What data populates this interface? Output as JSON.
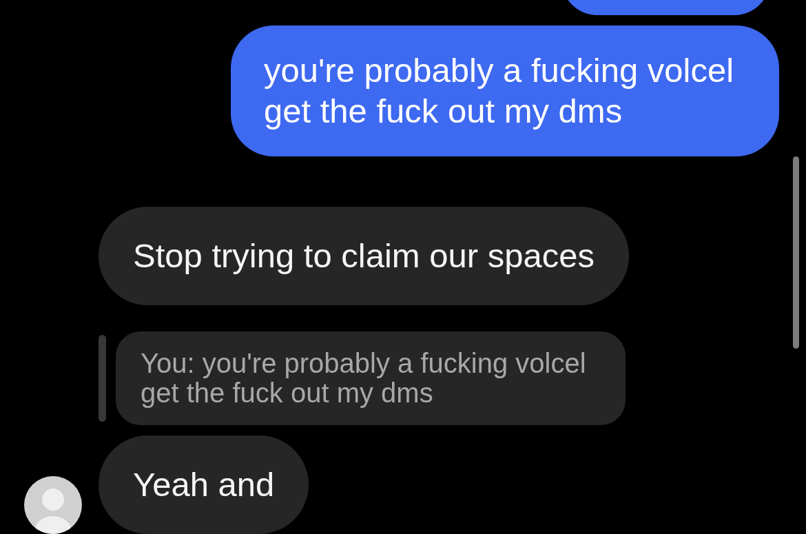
{
  "messages": [
    {
      "kind": "sent"
    },
    {
      "kind": "sent",
      "text": "you're probably a fucking volcel get the fuck out my dms"
    },
    {
      "kind": "received",
      "text": "Stop trying to claim our spaces"
    },
    {
      "kind": "reply_quote",
      "text": "You: you're probably a fucking volcel get the fuck out my dms"
    },
    {
      "kind": "received",
      "text": "Yeah and",
      "avatar": true
    }
  ]
}
